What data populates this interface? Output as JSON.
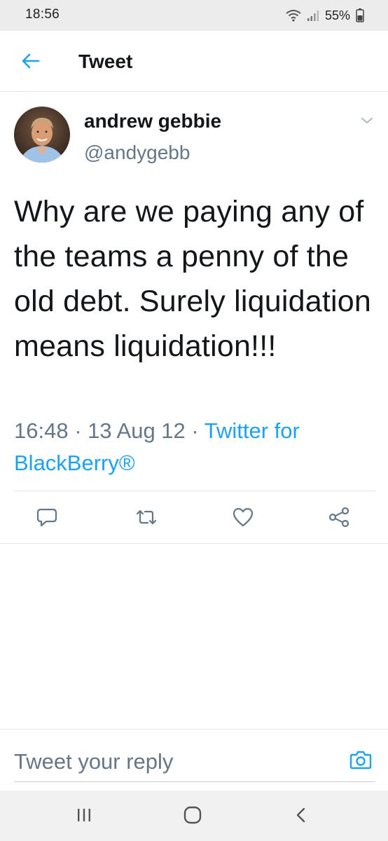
{
  "status_bar": {
    "time": "18:56",
    "battery": "55%"
  },
  "header": {
    "title": "Tweet"
  },
  "tweet": {
    "author_name": "andrew gebbie",
    "author_handle": "@andygebb",
    "text": "Why are we paying any of the teams a penny of the old debt. Surely liquidation means liquidation!!!",
    "time": "16:48",
    "date": "13 Aug 12",
    "separator": " · ",
    "source": "Twitter for BlackBerry®"
  },
  "actions": [
    "reply-icon",
    "retweet-icon",
    "like-icon",
    "share-icon"
  ],
  "reply": {
    "placeholder": "Tweet your reply"
  },
  "colors": {
    "accent": "#1da1f2",
    "secondary_text": "#657786",
    "primary_text": "#14171a",
    "divider": "#e1e8ed"
  }
}
